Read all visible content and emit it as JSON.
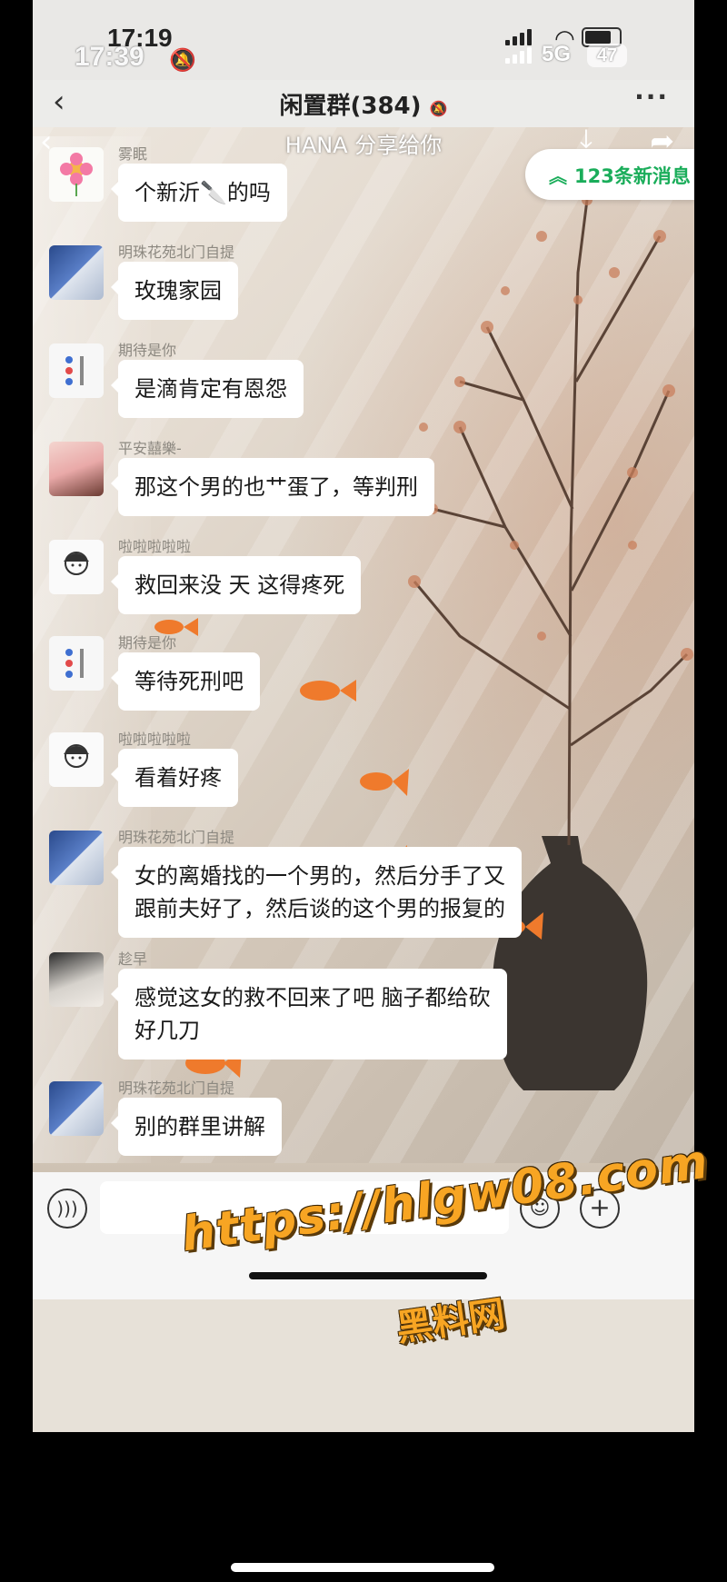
{
  "status": {
    "time_back": "17:19",
    "time_front": "17:39",
    "network": "5G",
    "battery": "47"
  },
  "nav": {
    "title": "闲置群(384)",
    "more": "···"
  },
  "share_banner": {
    "text": "HANA 分享给你"
  },
  "new_messages": {
    "text": "123条新消息"
  },
  "messages": [
    {
      "sender": "雾眠",
      "text": "个新沂🔪的吗"
    },
    {
      "sender": "明珠花苑北门自提",
      "text": "玫瑰家园"
    },
    {
      "sender": "期待是你",
      "text": "是滴肯定有恩怨"
    },
    {
      "sender": "平安囍樂-",
      "text": "那这个男的也艹蛋了，等判刑"
    },
    {
      "sender": "啦啦啦啦啦",
      "text": "救回来没 天 这得疼死"
    },
    {
      "sender": "期待是你",
      "text": "等待死刑吧"
    },
    {
      "sender": "啦啦啦啦啦",
      "text": "看着好疼"
    },
    {
      "sender": "明珠花苑北门自提",
      "line1": "女的离婚找的一个男的，然后分手了又",
      "line2": "跟前夫好了，然后谈的这个男的报复的"
    },
    {
      "sender": "趁早",
      "line1": "感觉这女的救不回来了吧 脑子都给砍",
      "line2": "好几刀"
    },
    {
      "sender": "明珠花苑北门自提",
      "text": "别的群里讲解"
    }
  ],
  "watermark": {
    "url": "https://hlgw08.com",
    "name": "黑料网"
  },
  "colors": {
    "accent_green": "#1aad5a",
    "watermark_orange": "#f7a523"
  }
}
